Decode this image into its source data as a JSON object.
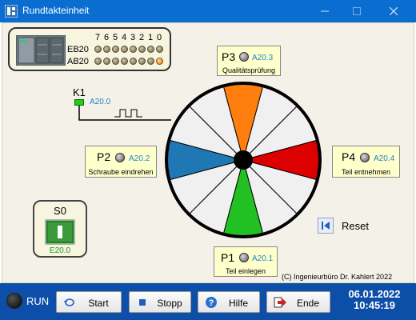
{
  "window": {
    "title": "Rundtakteinheit",
    "controls": [
      "minimize-icon",
      "maximize-icon",
      "close-icon"
    ]
  },
  "plc": {
    "bit_numbers": [
      "7",
      "6",
      "5",
      "4",
      "3",
      "2",
      "1",
      "0"
    ],
    "rows": [
      {
        "label": "EB20",
        "leds": [
          false,
          false,
          false,
          false,
          false,
          false,
          false,
          false
        ]
      },
      {
        "label": "AB20",
        "leds": [
          false,
          false,
          false,
          false,
          false,
          false,
          false,
          true
        ]
      }
    ]
  },
  "k1": {
    "label": "K1",
    "address": "A20.0",
    "state": "on"
  },
  "positions": {
    "p1": {
      "name": "P1",
      "address": "A20.1",
      "description": "Teil einlegen"
    },
    "p2": {
      "name": "P2",
      "address": "A20.2",
      "description": "Schraube eindrehen"
    },
    "p3": {
      "name": "P3",
      "address": "A20.3",
      "description": "Qualitätsprüfung"
    },
    "p4": {
      "name": "P4",
      "address": "A20.4",
      "description": "Teil entnehmen"
    }
  },
  "turntable": {
    "segment_colors": {
      "top": "#ff7f0e",
      "right": "#dd0000",
      "bottom": "#22c022",
      "left": "#1f78b4",
      "neutral": "#f0f0f0"
    }
  },
  "s0": {
    "label": "S0",
    "address": "E20.0"
  },
  "reset": {
    "label": "Reset"
  },
  "copyright": "(C) Ingenieurbüro Dr. Kahlert 2022",
  "status": {
    "run_label": "RUN"
  },
  "toolbar": {
    "start": "Start",
    "stopp": "Stopp",
    "hilfe": "Hilfe",
    "ende": "Ende"
  },
  "datetime": {
    "date": "06.01.2022",
    "time": "10:45:19"
  }
}
